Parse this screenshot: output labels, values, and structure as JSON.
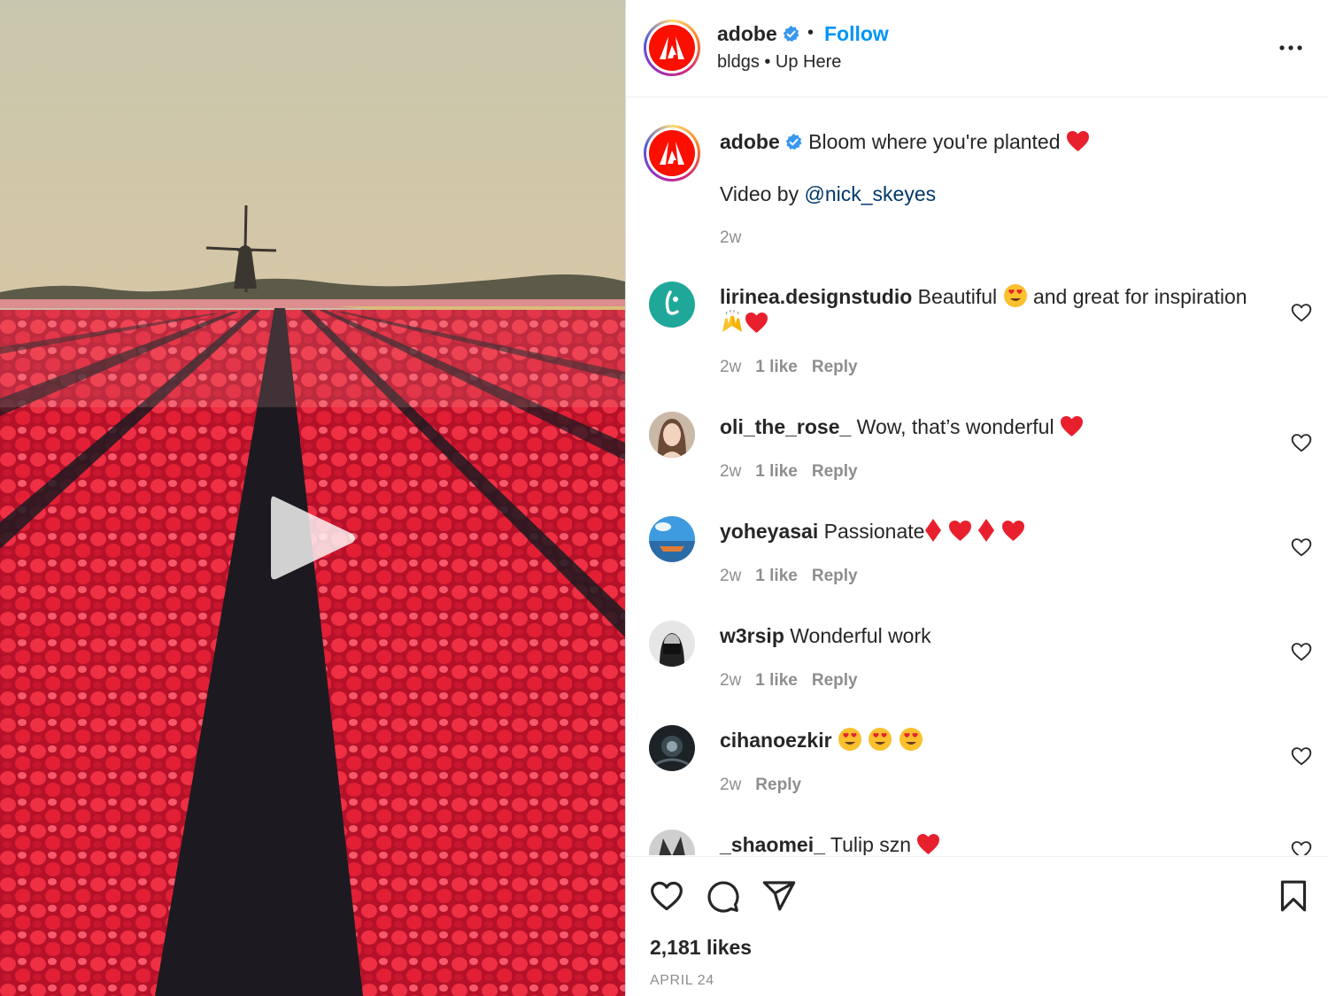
{
  "post": {
    "username": "adobe",
    "follow_label": "Follow",
    "separator": "•",
    "subtitle": "bldgs • Up Here",
    "caption_username": "adobe",
    "caption_text": "Bloom where you're planted",
    "credit_prefix": "Video by ",
    "credit_mention": "@nick_skeyes",
    "caption_time": "2w",
    "likes": "2,181 likes",
    "date": "APRIL 24"
  },
  "comments": [
    {
      "username": "lirinea.designstudio",
      "text_a": " Beautiful ",
      "text_b": " and great for inspiration",
      "time": "2w",
      "likes": "1 like",
      "reply": "Reply"
    },
    {
      "username": "oli_the_rose_",
      "text": " Wow, that’s wonderful ",
      "time": "2w",
      "likes": "1 like",
      "reply": "Reply"
    },
    {
      "username": "yoheyasai",
      "text": " Passionate",
      "time": "2w",
      "likes": "1 like",
      "reply": "Reply"
    },
    {
      "username": "w3rsip",
      "text": " Wonderful work",
      "time": "2w",
      "likes": "1 like",
      "reply": "Reply"
    },
    {
      "username": "cihanoezkir",
      "text": " ",
      "time": "2w",
      "reply": "Reply"
    },
    {
      "username": "_shaomei_",
      "text": " Tulip szn "
    }
  ],
  "colors": {
    "brand_red": "#fa0f00",
    "link_blue": "#0095f6",
    "mention_blue": "#00376b",
    "muted": "#8e8e8e",
    "verified_blue": "#3897f0"
  },
  "icons": [
    "adobe-logo-icon",
    "verified-badge-icon",
    "more-options-icon",
    "heart-icon",
    "comment-icon",
    "share-icon",
    "bookmark-icon",
    "play-icon"
  ]
}
